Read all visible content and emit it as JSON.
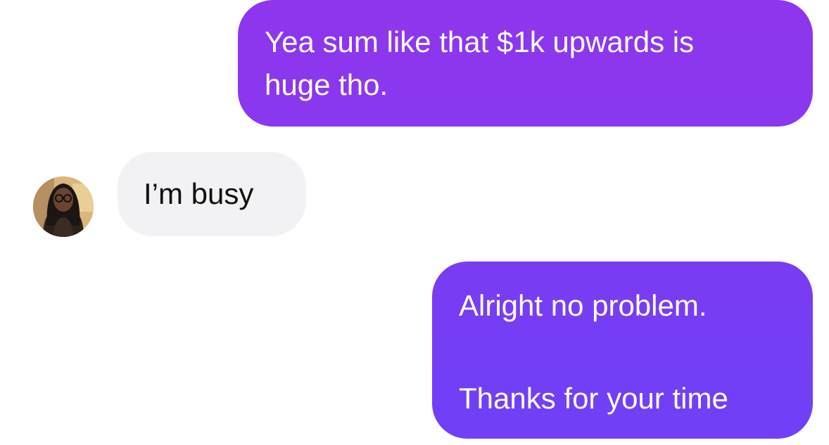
{
  "conversation": {
    "messages": [
      {
        "direction": "outgoing",
        "text": "Yea sum like that $1k upwards is\nhuge tho."
      },
      {
        "direction": "incoming",
        "text": "I’m busy"
      },
      {
        "direction": "outgoing",
        "text": "Alright no problem.\n\nThanks for your time"
      }
    ]
  },
  "contact": {
    "avatar_icon": "contact-avatar-photo"
  },
  "colors": {
    "outgoing_bubble": "#8B37EF",
    "outgoing_bubble_latest": "#7240F6",
    "incoming_bubble": "#F2F2F4",
    "outgoing_text": "#FFFFFF",
    "incoming_text": "#111111"
  }
}
